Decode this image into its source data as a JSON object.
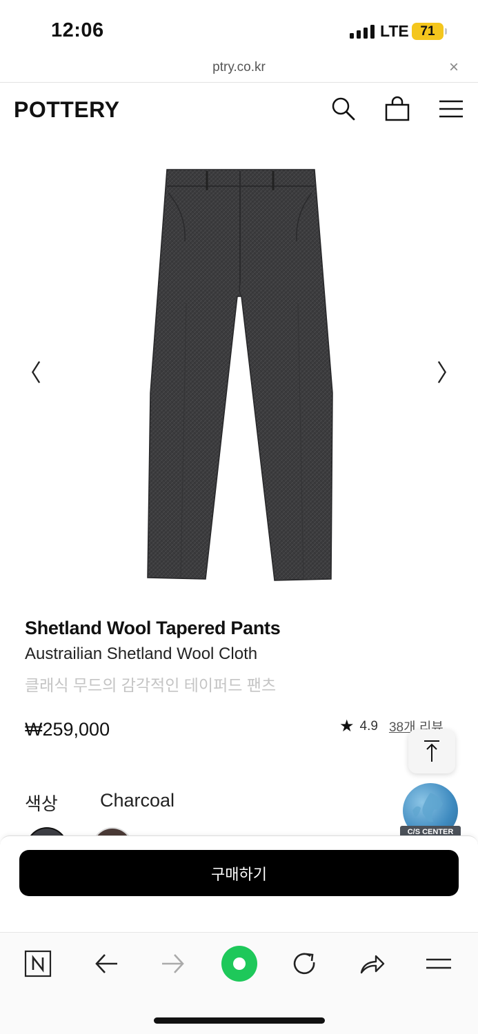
{
  "status_bar": {
    "time": "12:06",
    "network": "LTE",
    "battery": "71"
  },
  "url_bar": {
    "url": "ptry.co.kr",
    "close_glyph": "×"
  },
  "header": {
    "logo": "POTTERY",
    "icons": [
      "search-icon",
      "shopping-bag-icon",
      "menu-icon"
    ]
  },
  "gallery": {
    "prev_glyph": "〈",
    "next_glyph": "〉"
  },
  "product": {
    "name": "Shetland Wool Tapered Pants",
    "subtitle": "Austrailian Shetland Wool Cloth",
    "description": "클래식 무드의 감각적인 테이퍼드 팬츠",
    "price": "₩259,000",
    "rating": "4.9",
    "review_link": "38개 리뷰",
    "color_label": "색상",
    "color_value": "Charcoal",
    "swatches": [
      "Charcoal",
      "Brown"
    ]
  },
  "floating": {
    "top_button": "scroll-to-top",
    "cs_label": "C/S CENTER"
  },
  "buy_panel": {
    "buy_label": "구매하기"
  },
  "toolbar": {
    "items": [
      "naver-icon",
      "back-icon",
      "forward-icon",
      "green-dot-icon",
      "reload-icon",
      "share-icon",
      "menu-icon"
    ]
  },
  "colors": {
    "accent_green": "#1ec800",
    "battery_yellow": "#f4c61d",
    "button_black": "#000000",
    "desc_gray": "#c4c4c4"
  }
}
